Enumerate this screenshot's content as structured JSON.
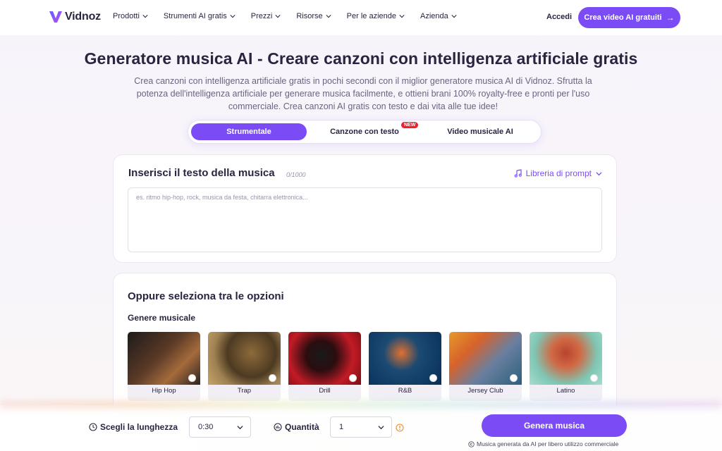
{
  "brand": {
    "name": "Vidnoz",
    "accent": "#7b4cf5"
  },
  "nav": {
    "menu": [
      {
        "label": "Prodotti"
      },
      {
        "label": "Strumenti AI gratis"
      },
      {
        "label": "Prezzi"
      },
      {
        "label": "Risorse"
      },
      {
        "label": "Per le aziende"
      },
      {
        "label": "Azienda"
      }
    ],
    "login": "Accedi",
    "cta": "Crea video AI gratuiti"
  },
  "hero": {
    "title": "Generatore musica AI - Creare canzoni con intelligenza artificiale gratis",
    "subtitle": "Crea canzoni con intelligenza artificiale gratis in pochi secondi con il miglior generatore musica AI di Vidnoz. Sfrutta la potenza dell'intelligenza artificiale per generare musica facilmente, e ottieni brani 100% royalty-free e pronti per l'uso commerciale. Crea canzoni AI gratis con testo e dai vita alle tue idee!"
  },
  "tabs": {
    "items": [
      {
        "label": "Strumentale",
        "active": true
      },
      {
        "label": "Canzone con testo",
        "badge": "NEW"
      },
      {
        "label": "Video musicale AI"
      }
    ]
  },
  "text_input": {
    "title": "Inserisci il testo della musica",
    "counter": "0/1000",
    "prompt_library": "Libreria di prompt",
    "value": "",
    "placeholder": "es. ritmo hip-hop, rock, musica da festa, chitarra elettronica..."
  },
  "options": {
    "title": "Oppure seleziona tra le opzioni",
    "genre_label": "Genere musicale",
    "genres": [
      {
        "name": "Hip Hop"
      },
      {
        "name": "Trap"
      },
      {
        "name": "Drill"
      },
      {
        "name": "R&B"
      },
      {
        "name": "Jersey Club"
      },
      {
        "name": "Latino"
      }
    ]
  },
  "bottom_bar": {
    "length_label": "Scegli la lunghezza",
    "length_value": "0:30",
    "quantity_label": "Quantità",
    "quantity_value": "1",
    "generate": "Genera musica",
    "footnote": "Musica generata da AI per libero utilizzo commerciale"
  }
}
